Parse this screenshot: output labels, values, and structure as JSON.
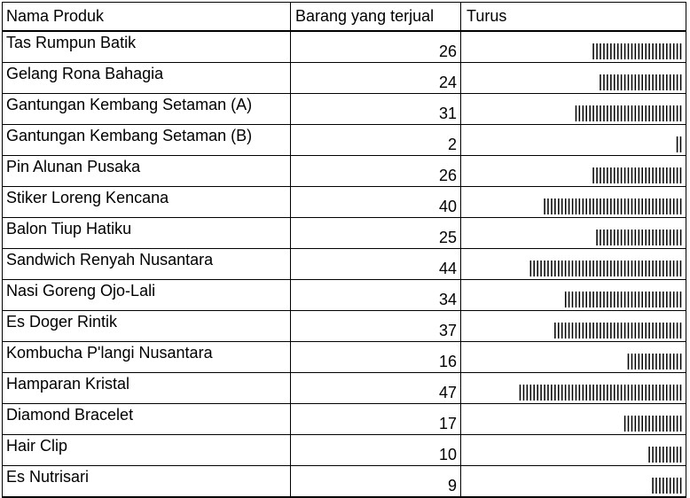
{
  "headers": {
    "product": "Nama Produk",
    "sold": "Barang yang terjual",
    "tally": "Turus"
  },
  "rows": [
    {
      "name": "Tas Rumpun Batik",
      "sold": 26
    },
    {
      "name": "Gelang Rona Bahagia",
      "sold": 24
    },
    {
      "name": "Gantungan Kembang Setaman (A)",
      "sold": 31
    },
    {
      "name": "Gantungan Kembang Setaman (B)",
      "sold": 2
    },
    {
      "name": "Pin Alunan Pusaka",
      "sold": 26
    },
    {
      "name": "Stiker Loreng Kencana",
      "sold": 40
    },
    {
      "name": "Balon Tiup Hatiku",
      "sold": 25
    },
    {
      "name": "Sandwich Renyah Nusantara",
      "sold": 44
    },
    {
      "name": "Nasi Goreng Ojo-Lali",
      "sold": 34
    },
    {
      "name": "Es Doger Rintik",
      "sold": 37
    },
    {
      "name": "Kombucha P'langi Nusantara",
      "sold": 16
    },
    {
      "name": "Hamparan Kristal",
      "sold": 47
    },
    {
      "name": "Diamond Bracelet",
      "sold": 17
    },
    {
      "name": "Hair Clip",
      "sold": 10
    },
    {
      "name": "Es Nutrisari",
      "sold": 9
    }
  ]
}
